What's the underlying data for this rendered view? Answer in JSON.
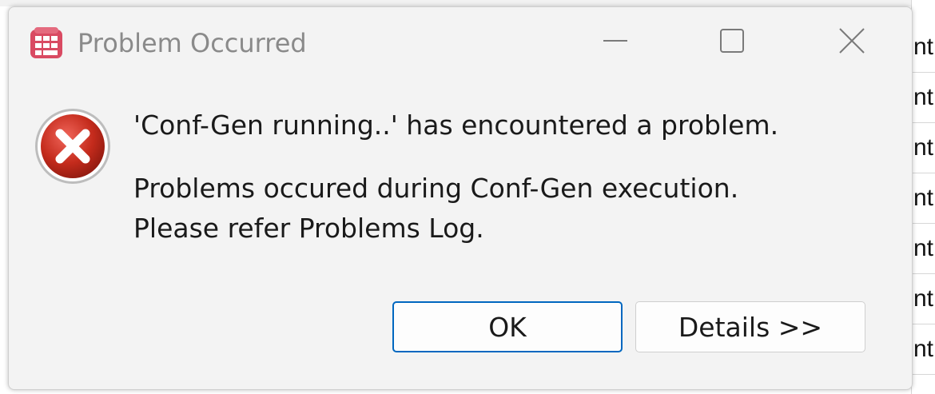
{
  "window": {
    "title": "Problem Occurred",
    "icons": {
      "app": "app-grid-icon",
      "minimize": "minimize-icon",
      "maximize": "maximize-icon",
      "close": "close-icon"
    }
  },
  "message": {
    "icon": "error-icon",
    "heading": "'Conf-Gen running..' has encountered a problem.",
    "body_lines": [
      "Problems occured during Conf-Gen execution.",
      "Please refer Problems Log."
    ]
  },
  "buttons": {
    "ok_label": "OK",
    "details_label": "Details >>"
  },
  "background": {
    "row_fragments": [
      "nt",
      "nt",
      "nt",
      "nt",
      "nt",
      "nt",
      "nt",
      "nt"
    ]
  },
  "colors": {
    "accent": "#0067c0",
    "error_red": "#c42b1c",
    "app_icon": "#d94a62"
  }
}
